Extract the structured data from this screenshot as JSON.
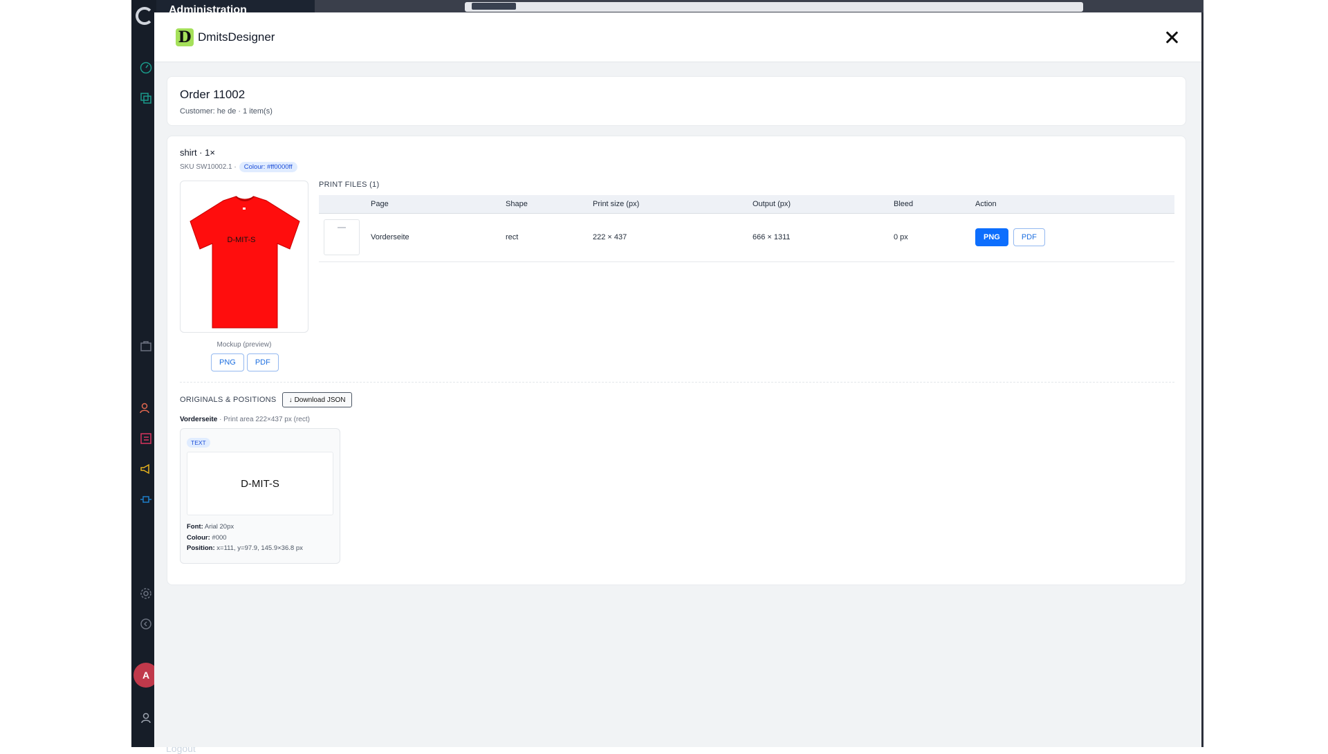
{
  "background": {
    "app_title": "Administration",
    "avatar_initial": "A",
    "logout_label": "Logout"
  },
  "modal": {
    "brand_logo_letter": "D",
    "brand_name": "DmitsDesigner",
    "close_icon": "close-icon"
  },
  "order": {
    "title": "Order 11002",
    "subtitle": "Customer: he de · 1 item(s)"
  },
  "item": {
    "name": "shirt · 1×",
    "sku": "SKU SW10002.1 ·",
    "colour_chip": "Colour: #ff0000ff",
    "shirt_color": "#ff0d0d",
    "mockup_text": "D-MIT-S",
    "mockup_caption": "Mockup (preview)",
    "mockup_png": "PNG",
    "mockup_pdf": "PDF"
  },
  "print_files": {
    "label": "PRINT FILES (1)",
    "columns": [
      "",
      "Page",
      "Shape",
      "Print size (px)",
      "Output (px)",
      "Bleed",
      "Action"
    ],
    "rows": [
      {
        "page": "Vorderseite",
        "shape": "rect",
        "print_size": "222 × 437",
        "output": "666 × 1311",
        "bleed": "0 px",
        "png_label": "PNG",
        "pdf_label": "PDF"
      }
    ]
  },
  "originals": {
    "label": "ORIGINALS & POSITIONS",
    "download_label": "Download JSON",
    "page_name": "Vorderseite",
    "page_detail": " · Print area 222×437 px (rect)",
    "layer": {
      "type_badge": "TEXT",
      "preview_text": "D-MIT-S",
      "font_label": "Font:",
      "font_value": " Arial 20px",
      "colour_label": "Colour:",
      "colour_value": " #000",
      "position_label": "Position:",
      "position_value": " x=111, y=97.9, 145.9×36.8 px"
    }
  },
  "accent_color": "#0d6efd"
}
